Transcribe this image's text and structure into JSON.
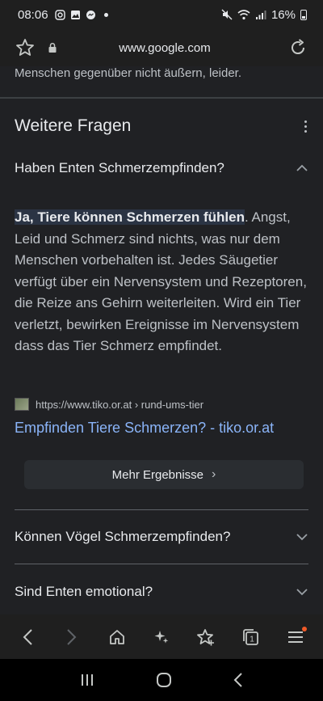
{
  "status_bar": {
    "time": "08:06",
    "battery": "16%"
  },
  "browser": {
    "url": "www.google.com"
  },
  "page": {
    "prev_text": "Menschen gegenüber nicht äußern, leider.",
    "section_title": "Weitere Fragen",
    "questions": [
      {
        "label": "Haben Enten Schmerzempfinden?"
      },
      {
        "label": "Können Vögel Schmerzempfinden?"
      },
      {
        "label": "Sind Enten emotional?"
      }
    ],
    "answer": {
      "highlight": "Ja, Tiere können Schmerzen fühlen",
      "rest": ". Angst, Leid und Schmerz sind nichts, was nur dem Menschen vorbehalten ist. Jedes Säugetier verfügt über ein Nervensystem und Rezeptoren, die Reize ans Gehirn weiterleiten. Wird ein Tier verletzt, bewirken Ereignisse im Nervensystem dass das Tier Schmerz empfindet."
    },
    "source": {
      "breadcrumb": "https://www.tiko.or.at › rund-ums-tier",
      "title": "Empfinden Tiere Schmerzen? - tiko.or.at"
    },
    "more_results": "Mehr Ergebnisse",
    "more_results_arrow": "›"
  },
  "toolbar": {
    "icons": [
      "back-icon",
      "forward-icon",
      "home-icon",
      "sparkle-icon",
      "bookmark-star-icon",
      "tabs-icon",
      "menu-icon"
    ],
    "tab_count": "1"
  }
}
